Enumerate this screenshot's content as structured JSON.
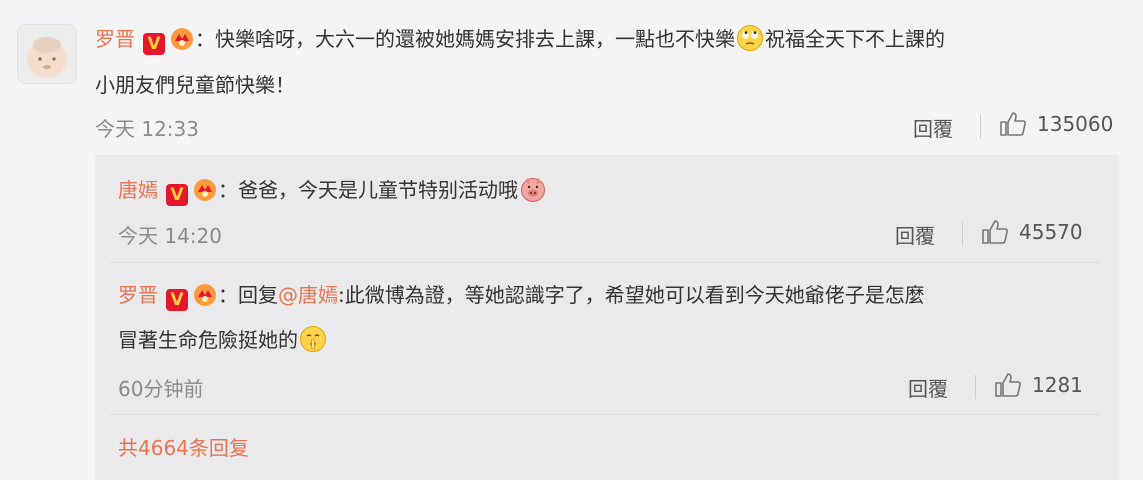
{
  "comment": {
    "username": "罗晋",
    "verified_badge": "V",
    "colon": "：",
    "text_line1_a": "快樂啥呀，大六一的還被她媽媽安排去上課，一點也不快樂",
    "text_line1_b": "祝福全天下不上課的",
    "text_line2": "小朋友們兒童節快樂！",
    "time": "今天 12:33",
    "reply_label": "回覆",
    "likes": "135060",
    "emoji": "rolling-eyes-emoji"
  },
  "replies": [
    {
      "username": "唐嫣",
      "verified_badge": "V",
      "colon": "：",
      "text": "爸爸，今天是儿童节特别活动哦",
      "time": "今天 14:20",
      "reply_label": "回覆",
      "likes": "45570",
      "emoji": "pig-face-emoji"
    },
    {
      "username": "罗晋",
      "verified_badge": "V",
      "colon": "：",
      "reply_prefix": "回复",
      "mention": "@唐嫣",
      "text_line1": ":此微博為證，等她認識字了，希望她可以看到今天她爺佬子是怎麼",
      "text_line2": "冒著生命危險挺她的",
      "time": "60分钟前",
      "reply_label": "回覆",
      "likes": "1281",
      "emoji": "shush-emoji"
    }
  ],
  "more_replies": "共4664条回复",
  "colors": {
    "name": "#eb7350",
    "badge_red": "#e6162d",
    "badge_gold": "#ffcf3a",
    "meta_gray": "#8c8c8c",
    "reply_bg": "#eaeaec",
    "page_bg": "#f4f4f6"
  }
}
